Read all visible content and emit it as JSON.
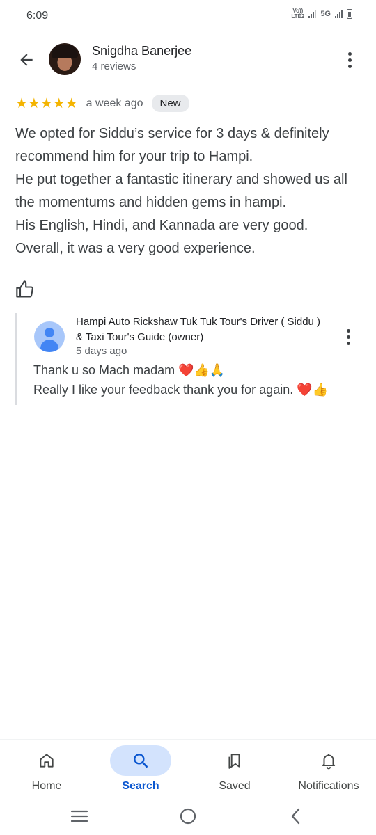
{
  "status_bar": {
    "time": "6:09",
    "volte_top": "Vo))",
    "volte_bottom": "LTE2",
    "network": "5G"
  },
  "header": {
    "user_name": "Snigdha Banerjee",
    "user_reviews": "4 reviews"
  },
  "review": {
    "stars": "★★★★★",
    "rating": 5,
    "date": "a week ago",
    "badge": "New",
    "text": "We opted for Siddu’s service for 3 days & definitely recommend him for your trip to Hampi.\nHe put together a fantastic itinerary and showed us all the momentums and hidden gems in hampi.\nHis English, Hindi, and Kannada are very good.\nOverall, it was a very good experience."
  },
  "owner_reply": {
    "name": "Hampi Auto Rickshaw Tuk Tuk Tour's Driver ( Siddu ) & Taxi Tour's Guide (owner)",
    "date": "5 days ago",
    "text": "Thank u so Mach madam ❤️👍🙏\nReally I like your feedback thank you for again. ❤️👍"
  },
  "bottom_nav": {
    "items": [
      {
        "label": "Home",
        "icon": "home-icon",
        "active": false
      },
      {
        "label": "Search",
        "icon": "search-icon",
        "active": true
      },
      {
        "label": "Saved",
        "icon": "saved-icon",
        "active": false
      },
      {
        "label": "Notifications",
        "icon": "bell-icon",
        "active": false
      }
    ]
  },
  "colors": {
    "star": "#f4b400",
    "active_nav_bg": "#d3e3fd",
    "active_nav_text": "#0b57d0",
    "owner_avatar": "#4285f4"
  }
}
